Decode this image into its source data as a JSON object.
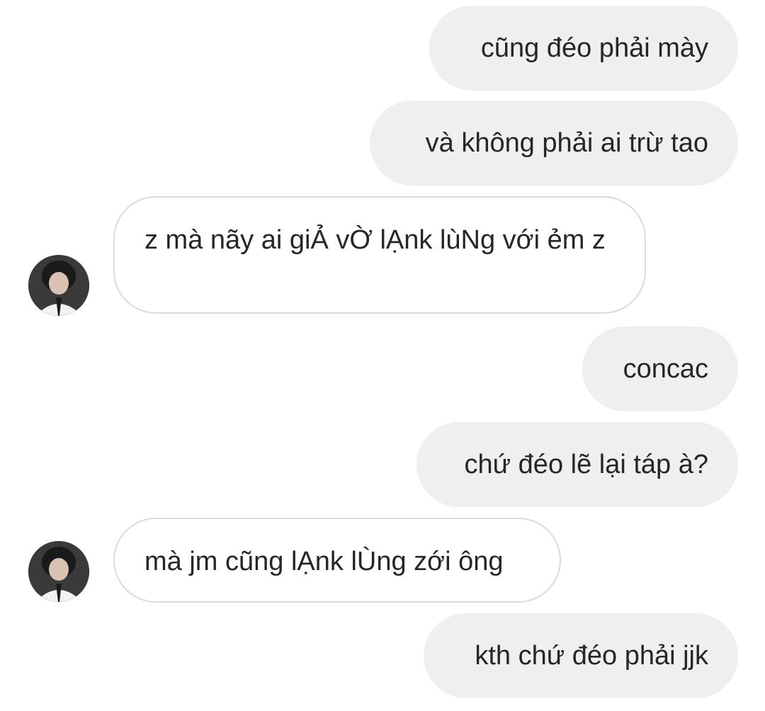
{
  "messages": [
    {
      "side": "outgoing",
      "text": "cũng đéo phải mày"
    },
    {
      "side": "outgoing",
      "text": "và không phải ai trừ tao"
    },
    {
      "side": "incoming",
      "text": "z mà nãy ai giẢ vỜ lẠnk lùNg với ẻm z",
      "avatar": "user-avatar-photo"
    },
    {
      "side": "outgoing",
      "text": "concac"
    },
    {
      "side": "outgoing",
      "text": "chứ đéo lẽ lại táp à?"
    },
    {
      "side": "incoming",
      "text": "mà jm cũng lẠnk lÙng zới ông",
      "avatar": "user-avatar-photo"
    },
    {
      "side": "outgoing",
      "text": "kth chứ đéo phải jjk"
    }
  ],
  "colors": {
    "outgoing_bubble": "#efefef",
    "incoming_border": "#dbdbdb",
    "text": "#262626",
    "background": "#ffffff"
  }
}
